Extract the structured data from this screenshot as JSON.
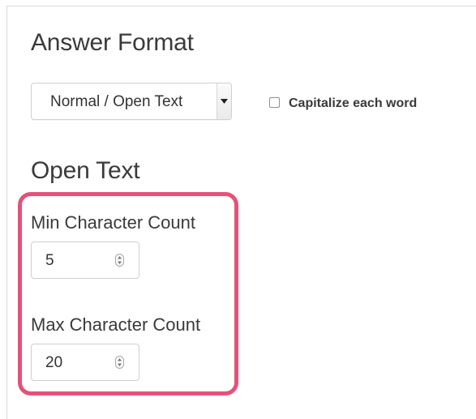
{
  "answer_format": {
    "heading": "Answer Format",
    "select": {
      "selected": "Normal / Open Text"
    },
    "capitalize": {
      "label": "Capitalize each word",
      "checked": false
    }
  },
  "open_text": {
    "heading": "Open Text",
    "min": {
      "label": "Min Character Count",
      "value": "5"
    },
    "max": {
      "label": "Max Character Count",
      "value": "20"
    }
  },
  "colors": {
    "highlight": "#e5517a",
    "heading_text": "#3a3a3a"
  },
  "icons": {
    "select_arrow": "triangle-down-icon",
    "stepper": "up-down-arrows-icon"
  }
}
